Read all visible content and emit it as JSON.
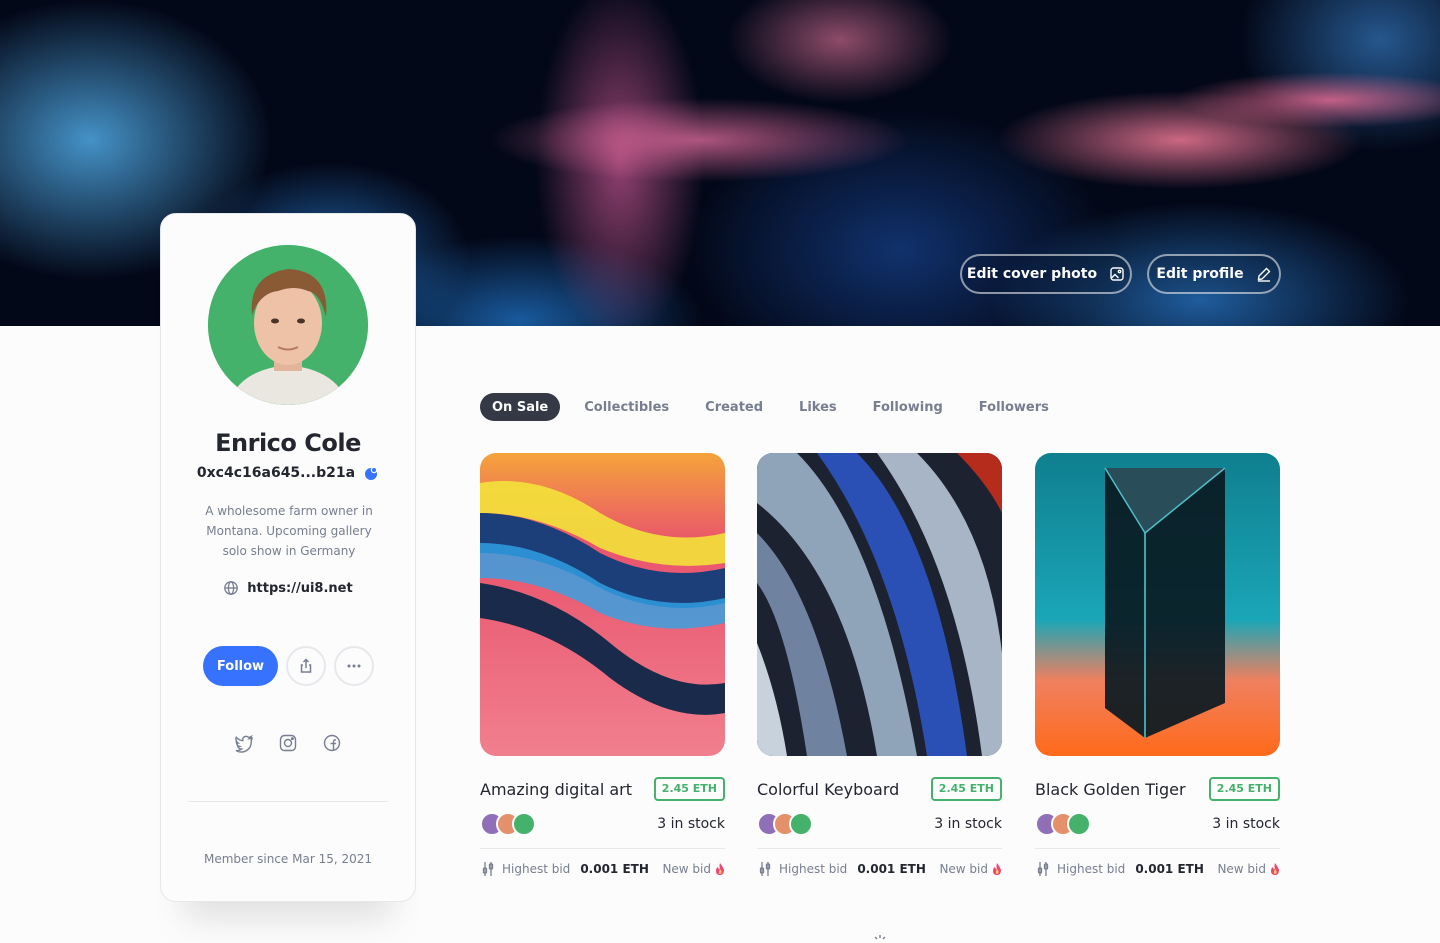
{
  "cover": {
    "edit_cover_label": "Edit cover photo",
    "edit_profile_label": "Edit profile"
  },
  "profile": {
    "name": "Enrico Cole",
    "address": "0xc4c16a645...b21a",
    "bio": "A wholesome farm owner in Montana. Upcoming gallery solo show in Germany",
    "website": "https://ui8.net",
    "follow_label": "Follow",
    "member_since": "Member since Mar 15, 2021",
    "socials": [
      "twitter-icon",
      "instagram-icon",
      "facebook-icon"
    ]
  },
  "tabs": [
    "On Sale",
    "Collectibles",
    "Created",
    "Likes",
    "Following",
    "Followers"
  ],
  "active_tab": "On Sale",
  "items": [
    {
      "title": "Amazing digital art",
      "price": "2.45 ETH",
      "stock": "3 in stock",
      "highest_bid_label": "Highest bid",
      "highest_bid_value": "0.001 ETH",
      "new_bid_label": "New bid"
    },
    {
      "title": "Colorful Keyboard",
      "price": "2.45 ETH",
      "stock": "3 in stock",
      "highest_bid_label": "Highest bid",
      "highest_bid_value": "0.001 ETH",
      "new_bid_label": "New bid"
    },
    {
      "title": "Black Golden Tiger",
      "price": "2.45 ETH",
      "stock": "3 in stock",
      "highest_bid_label": "Highest bid",
      "highest_bid_value": "0.001 ETH",
      "new_bid_label": "New bid"
    }
  ],
  "colors": {
    "primary": "#3772ff",
    "price_green": "#45b26b",
    "dark": "#23262f",
    "muted": "#777e90"
  }
}
